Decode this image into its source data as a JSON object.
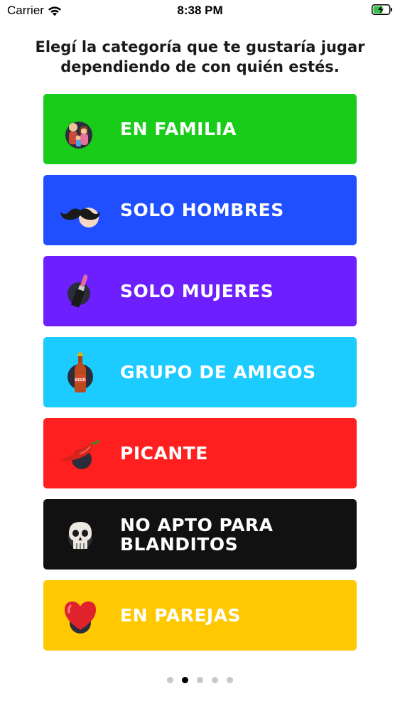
{
  "status_bar": {
    "carrier": "Carrier",
    "time": "8:38 PM",
    "wifi_icon": "wifi-icon",
    "battery_icon": "battery-charging-icon"
  },
  "instruction": "Elegí la categoría que te gustaría jugar dependiendo de con quién estés.",
  "categories": [
    {
      "label": "EN FAMILIA",
      "color": "#19CC19",
      "icon": "family-icon"
    },
    {
      "label": "SOLO HOMBRES",
      "color": "#1F4FFF",
      "icon": "mustache-icon"
    },
    {
      "label": "SOLO MUJERES",
      "color": "#6E1FFF",
      "icon": "lipstick-icon"
    },
    {
      "label": "GRUPO DE AMIGOS",
      "color": "#1CCBFF",
      "icon": "beer-bottle-icon"
    },
    {
      "label": "PICANTE",
      "color": "#FF1F1F",
      "icon": "chili-pepper-icon"
    },
    {
      "label": "NO APTO PARA BLANDITOS",
      "color": "#111111",
      "icon": "skull-icon"
    },
    {
      "label": "EN PAREJAS",
      "color": "#FFC800",
      "icon": "heart-icon"
    }
  ],
  "beer_label": "BEER",
  "pager": {
    "count": 5,
    "active_index": 1
  }
}
